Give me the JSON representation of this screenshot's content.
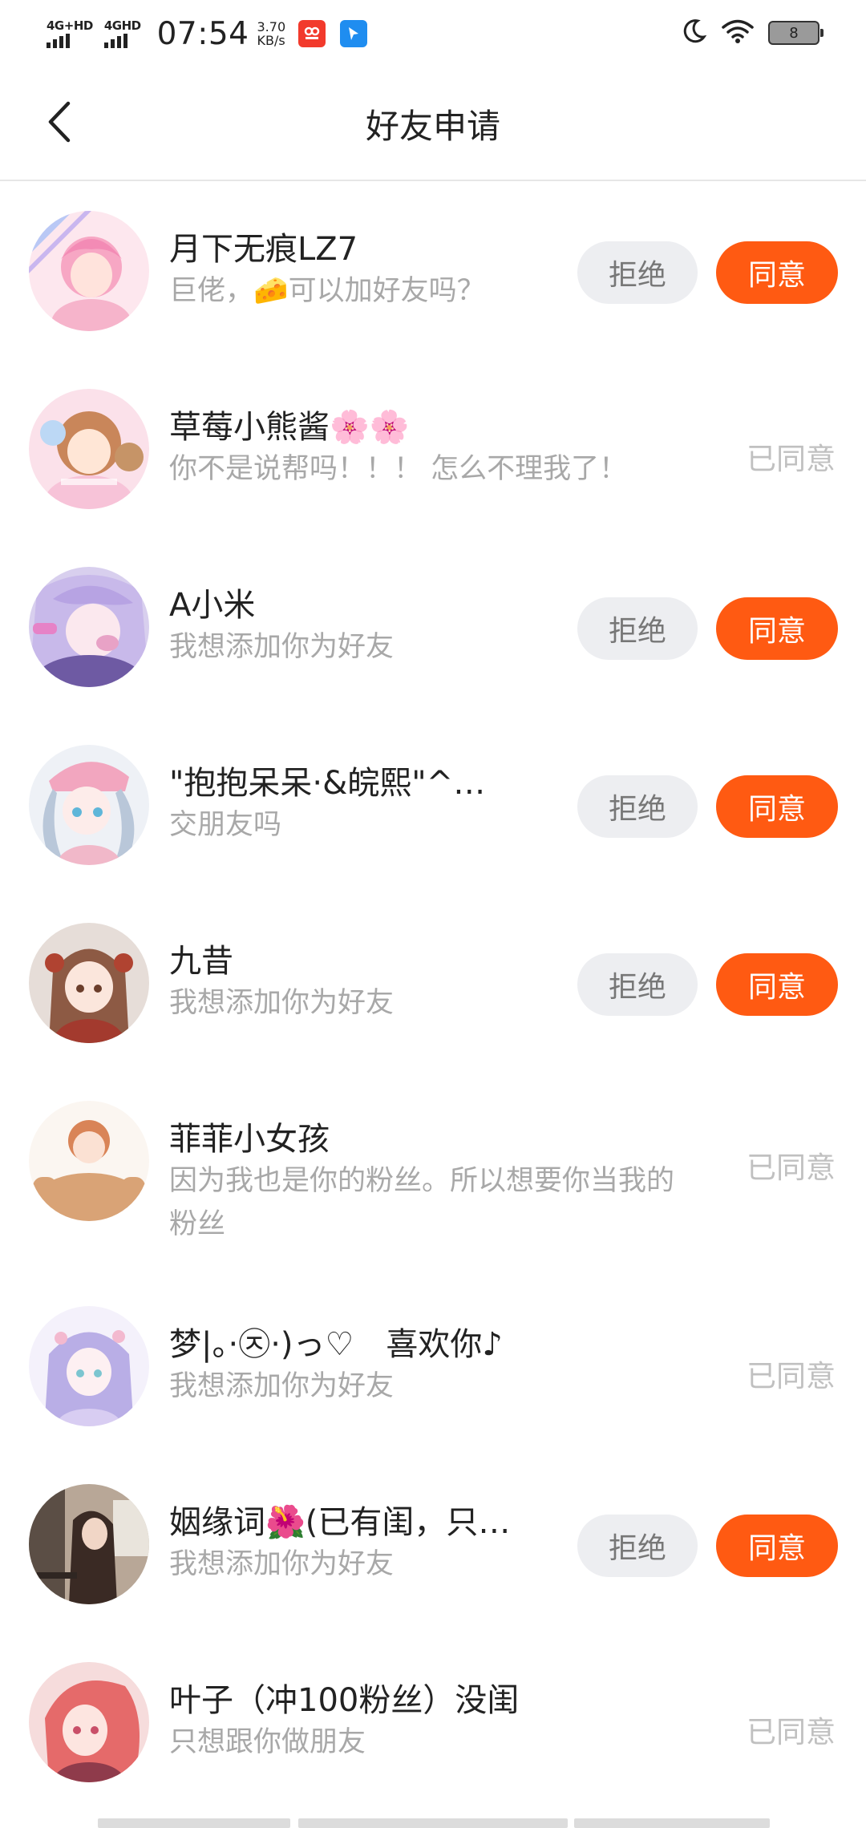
{
  "status_bar": {
    "sim1": "4G+HD",
    "sim2": "4GHD",
    "time": "07:54",
    "speed_value": "3.70",
    "speed_unit": "KB/s",
    "battery": "8"
  },
  "nav": {
    "title": "好友申请"
  },
  "labels": {
    "reject": "拒绝",
    "agree": "同意",
    "agreed": "已同意"
  },
  "requests": [
    {
      "name": "月下无痕LZ7",
      "message": "巨佬，🧀可以加好友吗？",
      "status": "pending"
    },
    {
      "name": "草莓小熊酱🌸🌸",
      "message": "你不是说帮吗！！！ 怎么不理我了！",
      "status": "agreed"
    },
    {
      "name": "A小米",
      "message": "我想添加你为好友",
      "status": "pending"
    },
    {
      "name": "\"抱抱呆呆·&皖熙\"^…",
      "message": "交朋友吗",
      "status": "pending"
    },
    {
      "name": "九昔",
      "message": "我想添加你为好友",
      "status": "pending"
    },
    {
      "name": "菲菲小女孩",
      "message": "因为我也是你的粉丝。所以想要你当我的粉丝",
      "status": "agreed"
    },
    {
      "name": "梦|。·㉨·)っ♡　喜欢你♪",
      "message": "我想添加你为好友",
      "status": "agreed"
    },
    {
      "name": "姻缘词🌺(已有闺，只…",
      "message": "我想添加你为好友",
      "status": "pending"
    },
    {
      "name": "叶子（冲100粉丝）没闺",
      "message": "只想跟你做朋友",
      "status": "agreed"
    }
  ],
  "icons": {
    "back": "chevron-left-icon",
    "moon": "moon-icon",
    "wifi": "wifi-icon",
    "battery": "battery-icon"
  },
  "colors": {
    "agree_button": "#ff5a12",
    "reject_button": "#edeef1",
    "agreed_text": "#c0c0c0"
  }
}
